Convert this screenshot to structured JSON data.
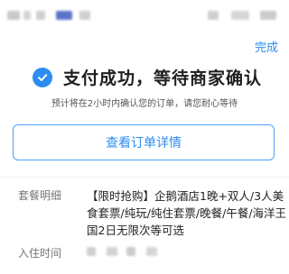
{
  "header": {
    "done_label": "完成"
  },
  "result": {
    "title": "支付成功，等待商家确认",
    "subtitle": "预计将在2小时内确认您的订单，请您耐心等待",
    "icon": "check-circle-icon",
    "accent_color": "#2d8cf0"
  },
  "actions": {
    "view_order_label": "查看订单详情"
  },
  "details": {
    "package_label": "套餐明细",
    "package_value": "【限时抢购】企鹅酒店1晚+双人/3人美食套票/纯玩/纯住套票/晚餐/午餐/海洋王国2日无限次等可选",
    "checkin_label": "入住时间"
  }
}
